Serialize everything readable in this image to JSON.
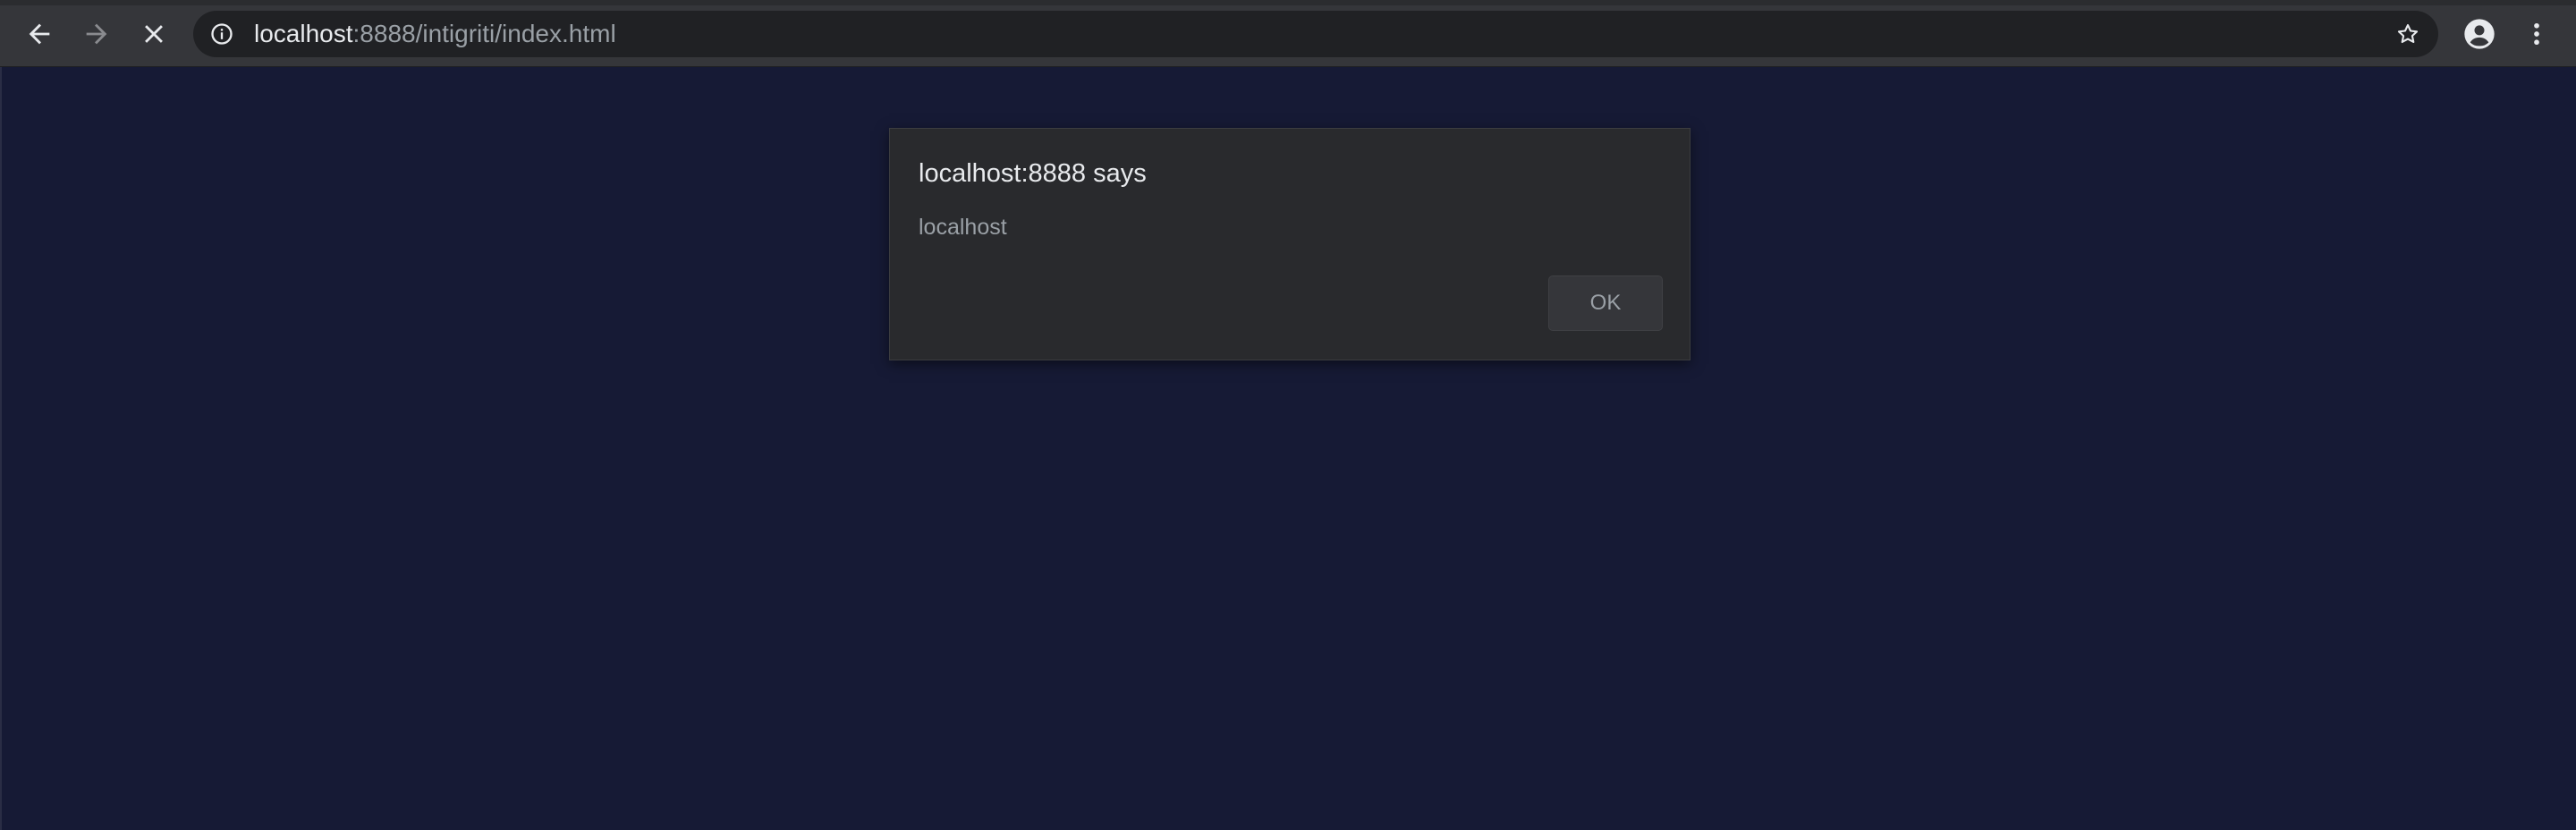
{
  "browser": {
    "url_host": "localhost",
    "url_rest": ":8888/intigriti/index.html",
    "icons": {
      "back": "arrow-left-icon",
      "forward": "arrow-right-icon",
      "stop": "close-icon",
      "site_info": "info-icon",
      "bookmark": "star-icon",
      "profile": "account-circle-icon",
      "menu": "more-vert-icon"
    }
  },
  "dialog": {
    "title": "localhost:8888 says",
    "message": "localhost",
    "ok_label": "OK"
  },
  "colors": {
    "page_background": "#161a35",
    "toolbar": "#35363a",
    "omnibox": "#202124",
    "dialog": "#292a2d"
  }
}
